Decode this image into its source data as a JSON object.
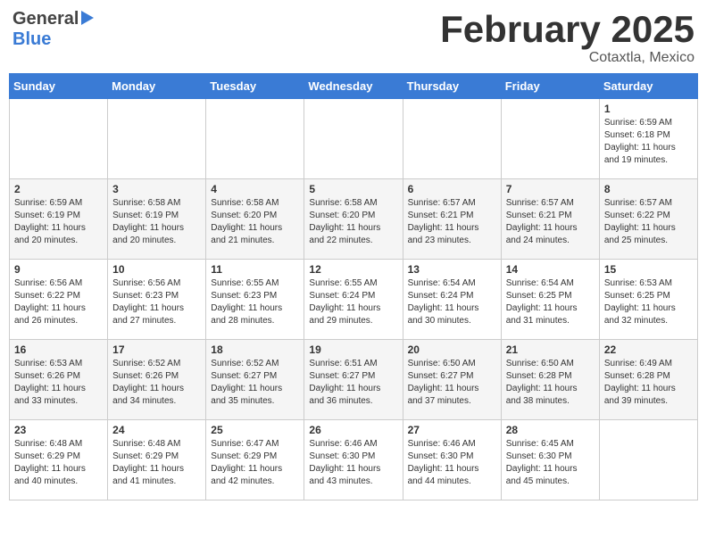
{
  "header": {
    "logo_general": "General",
    "logo_blue": "Blue",
    "title": "February 2025",
    "location": "Cotaxtla, Mexico"
  },
  "days_of_week": [
    "Sunday",
    "Monday",
    "Tuesday",
    "Wednesday",
    "Thursday",
    "Friday",
    "Saturday"
  ],
  "weeks": [
    [
      {
        "day": "",
        "info": ""
      },
      {
        "day": "",
        "info": ""
      },
      {
        "day": "",
        "info": ""
      },
      {
        "day": "",
        "info": ""
      },
      {
        "day": "",
        "info": ""
      },
      {
        "day": "",
        "info": ""
      },
      {
        "day": "1",
        "info": "Sunrise: 6:59 AM\nSunset: 6:18 PM\nDaylight: 11 hours\nand 19 minutes."
      }
    ],
    [
      {
        "day": "2",
        "info": "Sunrise: 6:59 AM\nSunset: 6:19 PM\nDaylight: 11 hours\nand 20 minutes."
      },
      {
        "day": "3",
        "info": "Sunrise: 6:58 AM\nSunset: 6:19 PM\nDaylight: 11 hours\nand 20 minutes."
      },
      {
        "day": "4",
        "info": "Sunrise: 6:58 AM\nSunset: 6:20 PM\nDaylight: 11 hours\nand 21 minutes."
      },
      {
        "day": "5",
        "info": "Sunrise: 6:58 AM\nSunset: 6:20 PM\nDaylight: 11 hours\nand 22 minutes."
      },
      {
        "day": "6",
        "info": "Sunrise: 6:57 AM\nSunset: 6:21 PM\nDaylight: 11 hours\nand 23 minutes."
      },
      {
        "day": "7",
        "info": "Sunrise: 6:57 AM\nSunset: 6:21 PM\nDaylight: 11 hours\nand 24 minutes."
      },
      {
        "day": "8",
        "info": "Sunrise: 6:57 AM\nSunset: 6:22 PM\nDaylight: 11 hours\nand 25 minutes."
      }
    ],
    [
      {
        "day": "9",
        "info": "Sunrise: 6:56 AM\nSunset: 6:22 PM\nDaylight: 11 hours\nand 26 minutes."
      },
      {
        "day": "10",
        "info": "Sunrise: 6:56 AM\nSunset: 6:23 PM\nDaylight: 11 hours\nand 27 minutes."
      },
      {
        "day": "11",
        "info": "Sunrise: 6:55 AM\nSunset: 6:23 PM\nDaylight: 11 hours\nand 28 minutes."
      },
      {
        "day": "12",
        "info": "Sunrise: 6:55 AM\nSunset: 6:24 PM\nDaylight: 11 hours\nand 29 minutes."
      },
      {
        "day": "13",
        "info": "Sunrise: 6:54 AM\nSunset: 6:24 PM\nDaylight: 11 hours\nand 30 minutes."
      },
      {
        "day": "14",
        "info": "Sunrise: 6:54 AM\nSunset: 6:25 PM\nDaylight: 11 hours\nand 31 minutes."
      },
      {
        "day": "15",
        "info": "Sunrise: 6:53 AM\nSunset: 6:25 PM\nDaylight: 11 hours\nand 32 minutes."
      }
    ],
    [
      {
        "day": "16",
        "info": "Sunrise: 6:53 AM\nSunset: 6:26 PM\nDaylight: 11 hours\nand 33 minutes."
      },
      {
        "day": "17",
        "info": "Sunrise: 6:52 AM\nSunset: 6:26 PM\nDaylight: 11 hours\nand 34 minutes."
      },
      {
        "day": "18",
        "info": "Sunrise: 6:52 AM\nSunset: 6:27 PM\nDaylight: 11 hours\nand 35 minutes."
      },
      {
        "day": "19",
        "info": "Sunrise: 6:51 AM\nSunset: 6:27 PM\nDaylight: 11 hours\nand 36 minutes."
      },
      {
        "day": "20",
        "info": "Sunrise: 6:50 AM\nSunset: 6:27 PM\nDaylight: 11 hours\nand 37 minutes."
      },
      {
        "day": "21",
        "info": "Sunrise: 6:50 AM\nSunset: 6:28 PM\nDaylight: 11 hours\nand 38 minutes."
      },
      {
        "day": "22",
        "info": "Sunrise: 6:49 AM\nSunset: 6:28 PM\nDaylight: 11 hours\nand 39 minutes."
      }
    ],
    [
      {
        "day": "23",
        "info": "Sunrise: 6:48 AM\nSunset: 6:29 PM\nDaylight: 11 hours\nand 40 minutes."
      },
      {
        "day": "24",
        "info": "Sunrise: 6:48 AM\nSunset: 6:29 PM\nDaylight: 11 hours\nand 41 minutes."
      },
      {
        "day": "25",
        "info": "Sunrise: 6:47 AM\nSunset: 6:29 PM\nDaylight: 11 hours\nand 42 minutes."
      },
      {
        "day": "26",
        "info": "Sunrise: 6:46 AM\nSunset: 6:30 PM\nDaylight: 11 hours\nand 43 minutes."
      },
      {
        "day": "27",
        "info": "Sunrise: 6:46 AM\nSunset: 6:30 PM\nDaylight: 11 hours\nand 44 minutes."
      },
      {
        "day": "28",
        "info": "Sunrise: 6:45 AM\nSunset: 6:30 PM\nDaylight: 11 hours\nand 45 minutes."
      },
      {
        "day": "",
        "info": ""
      }
    ]
  ]
}
